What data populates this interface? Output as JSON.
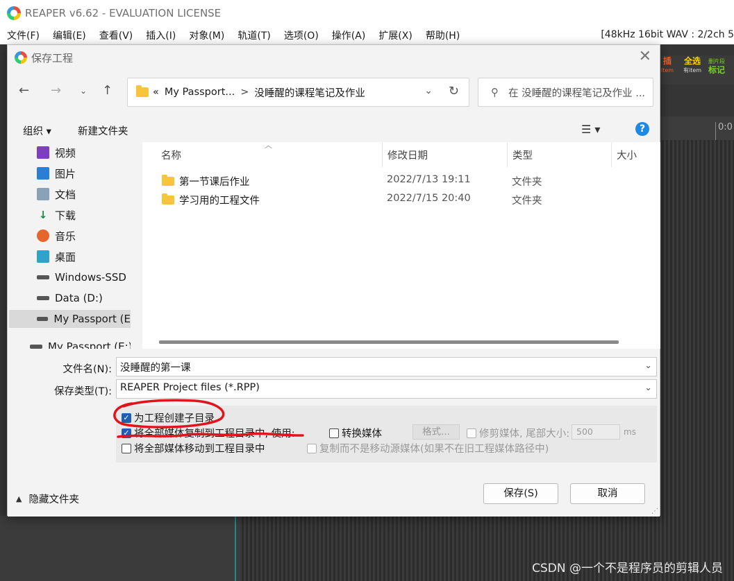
{
  "app": {
    "title": "REAPER v6.62 - EVALUATION LICENSE",
    "menu": [
      "文件(F)",
      "编辑(E)",
      "查看(V)",
      "插入(I)",
      "对象(M)",
      "轨道(T)",
      "选项(O)",
      "操作(A)",
      "扩展(X)",
      "帮助(H)"
    ],
    "status": "[48kHz 16bit WAV : 2/2ch 5",
    "toolbar": {
      "btn1": "插",
      "btn1_sub": "ltem",
      "btn2": "全选",
      "btn2_sub": "有item",
      "btn3_top": "删片段",
      "btn3": "标记"
    },
    "ruler": "0:0",
    "colors": {
      "accent_red": "#ff5a1a",
      "accent_yellow": "#ffd400",
      "accent_green": "#7bd21f"
    }
  },
  "dialog": {
    "title": "保存工程",
    "address": {
      "prefix": "«",
      "segment1": "My Passport...",
      "separator": ">",
      "segment2": "没睡醒的课程笔记及作业"
    },
    "search_placeholder": "在 没睡醒的课程笔记及作业 ...",
    "commands": {
      "organize": "组织 ▾",
      "new_folder": "新建文件夹"
    },
    "nav_items": [
      {
        "label": "视频",
        "icon": "video-icon"
      },
      {
        "label": "图片",
        "icon": "pictures-icon"
      },
      {
        "label": "文档",
        "icon": "documents-icon"
      },
      {
        "label": "下载",
        "icon": "download-icon"
      },
      {
        "label": "音乐",
        "icon": "music-icon"
      },
      {
        "label": "桌面",
        "icon": "desktop-icon"
      },
      {
        "label": "Windows-SSD",
        "icon": "drive-icon"
      },
      {
        "label": "Data (D:)",
        "icon": "drive-icon"
      },
      {
        "label": "My Passport (E",
        "icon": "drive-icon",
        "selected": true
      },
      {
        "label": "My Passport (E:)",
        "icon": "drive-icon"
      }
    ],
    "columns": {
      "name": "名称",
      "date": "修改日期",
      "type": "类型",
      "size": "大小"
    },
    "files": [
      {
        "name": "第一节课后作业",
        "date": "2022/7/13 19:11",
        "type": "文件夹"
      },
      {
        "name": "学习用的工程文件",
        "date": "2022/7/15 20:40",
        "type": "文件夹"
      }
    ],
    "filename_label": "文件名(N):",
    "filename_value": "没睡醒的第一课",
    "filetype_label": "保存类型(T):",
    "filetype_value": "REAPER Project files (*.RPP)",
    "options": {
      "create_subdir": "为工程创建子目录",
      "copy_media": "将全部媒体复制到工程目录中, 使用:",
      "move_media": "将全部媒体移动到工程目录中",
      "convert_media": "转换媒体",
      "format_btn": "格式...",
      "trim_media": "修剪媒体, 尾部大小:",
      "trim_value": "500",
      "trim_unit": "ms",
      "copy_not_move": "复制而不是移动源媒体(如果不在旧工程媒体路径中)"
    },
    "hide_folders": "隐藏文件夹",
    "save_button": "保存(S)",
    "cancel_button": "取消"
  },
  "watermark": "CSDN @一个不是程序员的剪辑人员"
}
